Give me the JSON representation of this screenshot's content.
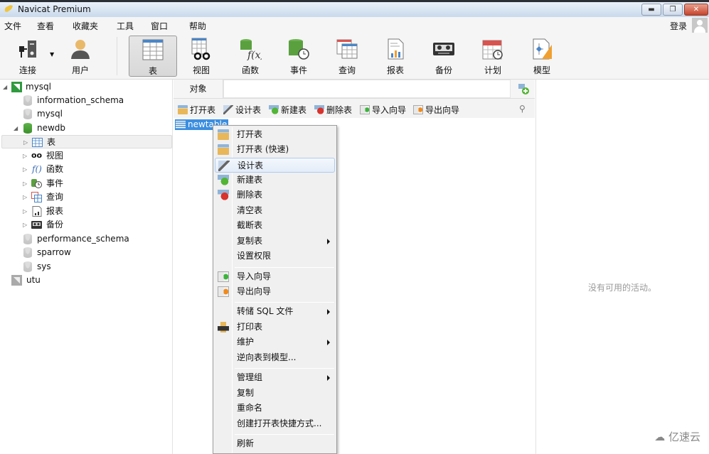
{
  "window": {
    "title": "Navicat Premium",
    "controls": [
      "minimize",
      "restore",
      "close"
    ]
  },
  "menubar": {
    "items": [
      "文件",
      "查看",
      "收藏夹",
      "工具",
      "窗口",
      "帮助"
    ],
    "login": "登录"
  },
  "toolbar": {
    "buttons": [
      {
        "label": "连接",
        "icon": "connection-icon",
        "has_dropdown": true
      },
      {
        "label": "用户",
        "icon": "user-icon"
      },
      {
        "label": "表",
        "icon": "table-icon",
        "active": true
      },
      {
        "label": "视图",
        "icon": "view-icon"
      },
      {
        "label": "函数",
        "icon": "function-icon"
      },
      {
        "label": "事件",
        "icon": "event-icon"
      },
      {
        "label": "查询",
        "icon": "query-icon"
      },
      {
        "label": "报表",
        "icon": "report-icon"
      },
      {
        "label": "备份",
        "icon": "backup-icon"
      },
      {
        "label": "计划",
        "icon": "schedule-icon"
      },
      {
        "label": "模型",
        "icon": "model-icon"
      }
    ]
  },
  "tree": [
    {
      "label": "mysql",
      "type": "connection",
      "expanded": true
    },
    {
      "label": "information_schema",
      "type": "database"
    },
    {
      "label": "mysql",
      "type": "database"
    },
    {
      "label": "newdb",
      "type": "database",
      "expanded": true,
      "active": true
    },
    {
      "label": "表",
      "type": "tables",
      "selected": true
    },
    {
      "label": "视图",
      "type": "views"
    },
    {
      "label": "函数",
      "type": "functions"
    },
    {
      "label": "事件",
      "type": "events"
    },
    {
      "label": "查询",
      "type": "queries"
    },
    {
      "label": "报表",
      "type": "reports"
    },
    {
      "label": "备份",
      "type": "backups"
    },
    {
      "label": "performance_schema",
      "type": "database"
    },
    {
      "label": "sparrow",
      "type": "database"
    },
    {
      "label": "sys",
      "type": "database"
    },
    {
      "label": "utu",
      "type": "connection"
    }
  ],
  "objects": {
    "tab": "对象",
    "search_value": "",
    "actions": [
      "打开表",
      "设计表",
      "新建表",
      "删除表",
      "导入向导",
      "导出向导"
    ],
    "items": [
      {
        "name": "newtable",
        "selected": true
      }
    ]
  },
  "context_menu": {
    "items": [
      {
        "label": "打开表",
        "icon": "open-table-icon"
      },
      {
        "label": "打开表 (快速)",
        "icon": "open-table-fast-icon"
      },
      {
        "label": "设计表",
        "icon": "design-table-icon",
        "highlighted": true
      },
      {
        "label": "新建表",
        "icon": "new-table-icon"
      },
      {
        "label": "删除表",
        "icon": "delete-table-icon"
      },
      {
        "label": "清空表"
      },
      {
        "label": "截断表"
      },
      {
        "label": "复制表",
        "submenu": true
      },
      {
        "label": "设置权限"
      },
      {
        "separator": true
      },
      {
        "label": "导入向导",
        "icon": "import-wizard-icon"
      },
      {
        "label": "导出向导",
        "icon": "export-wizard-icon"
      },
      {
        "separator": true
      },
      {
        "label": "转储 SQL 文件",
        "submenu": true
      },
      {
        "label": "打印表",
        "icon": "printer-icon"
      },
      {
        "label": "维护",
        "submenu": true
      },
      {
        "label": "逆向表到模型..."
      },
      {
        "separator": true
      },
      {
        "label": "管理组",
        "submenu": true
      },
      {
        "label": "复制"
      },
      {
        "label": "重命名"
      },
      {
        "label": "创建打开表快捷方式..."
      },
      {
        "separator": true
      },
      {
        "label": "刷新"
      }
    ]
  },
  "activity": {
    "empty_text": "没有可用的活动。"
  },
  "watermark": "亿速云"
}
